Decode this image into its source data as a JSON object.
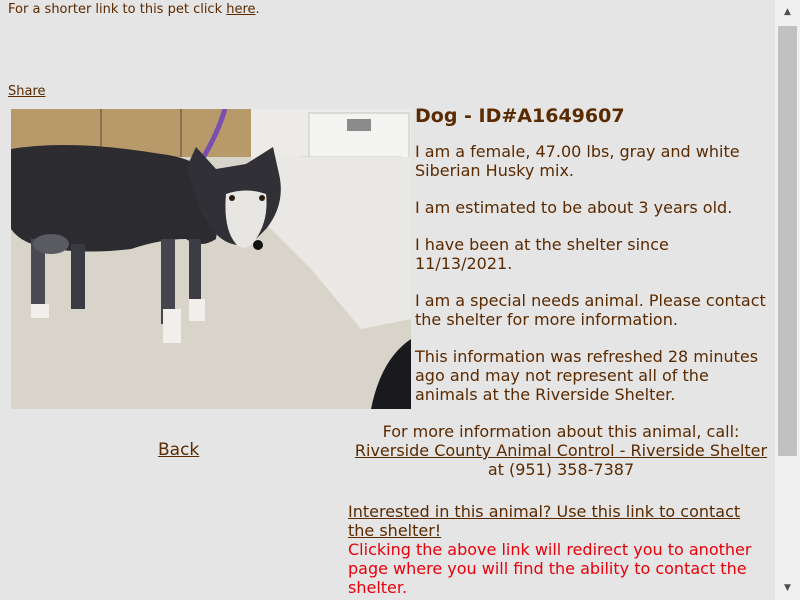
{
  "shortlink": {
    "prefix": "For a shorter link to this pet click ",
    "link": "here",
    "suffix": "."
  },
  "share": "Share",
  "pet": {
    "title": "Dog - ID#A1649607",
    "paragraphs": [
      "I am a female, 47.00 lbs, gray and white Siberian Husky mix.",
      "I am estimated to be about 3 years old.",
      "I have been at the shelter since 11/13/2021.",
      "I am a special needs animal. Please contact the shelter for more information.",
      "This information was refreshed 28 minutes ago and may not represent all of the animals at the Riverside Shelter."
    ]
  },
  "back": "Back",
  "contact": {
    "intro": "For more information about this animal, call:",
    "shelter_link": "Riverside County Animal Control - Riverside Shelter",
    "phone": " at (951) 358-7387"
  },
  "interest": {
    "link": "Interested in this animal? Use this link to contact the shelter!",
    "note": "Clicking the above link will redirect you to another page where you will find the ability to contact the shelter."
  },
  "colors": {
    "text": "#5a2a00",
    "warning": "#e8000b",
    "background": "#e5e5e5"
  }
}
